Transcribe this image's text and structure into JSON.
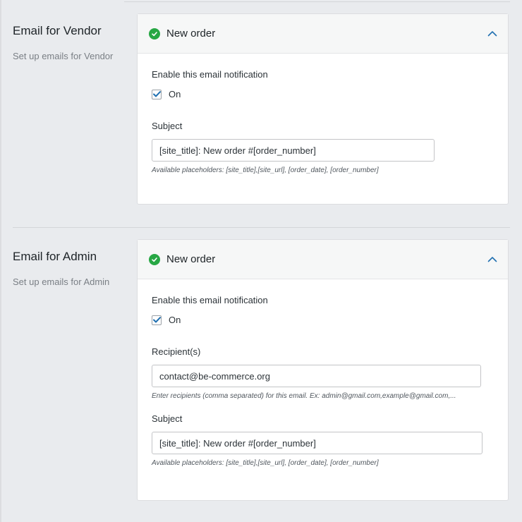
{
  "sections": [
    {
      "title": "Email for Vendor",
      "description": "Set up emails for Vendor",
      "card": {
        "title": "New order",
        "enable_label": "Enable this email notification",
        "checkbox_label": "On",
        "checked": true,
        "subject_label": "Subject",
        "subject_value": "[site_title]: New order #[order_number]",
        "subject_hint": "Available placeholders: [site_title],[site_url], [order_date], [order_number]"
      }
    },
    {
      "title": "Email for Admin",
      "description": "Set up emails for Admin",
      "card": {
        "title": "New order",
        "enable_label": "Enable this email notification",
        "checkbox_label": "On",
        "checked": true,
        "recipients_label": "Recipient(s)",
        "recipients_value": "contact@be-commerce.org",
        "recipients_hint": "Enter recipients (comma separated) for this email. Ex: admin@gmail.com,example@gmail.com,...",
        "subject_label": "Subject",
        "subject_value": "[site_title]: New order #[order_number]",
        "subject_hint": "Available placeholders: [site_title],[site_url], [order_date], [order_number]"
      }
    }
  ],
  "icons": {
    "status": "check-circle-icon",
    "collapse": "chevron-up-icon",
    "checkbox": "checkmark-icon"
  },
  "colors": {
    "background": "#e9ebee",
    "status_green": "#27a744",
    "accent_blue": "#2271b1"
  }
}
